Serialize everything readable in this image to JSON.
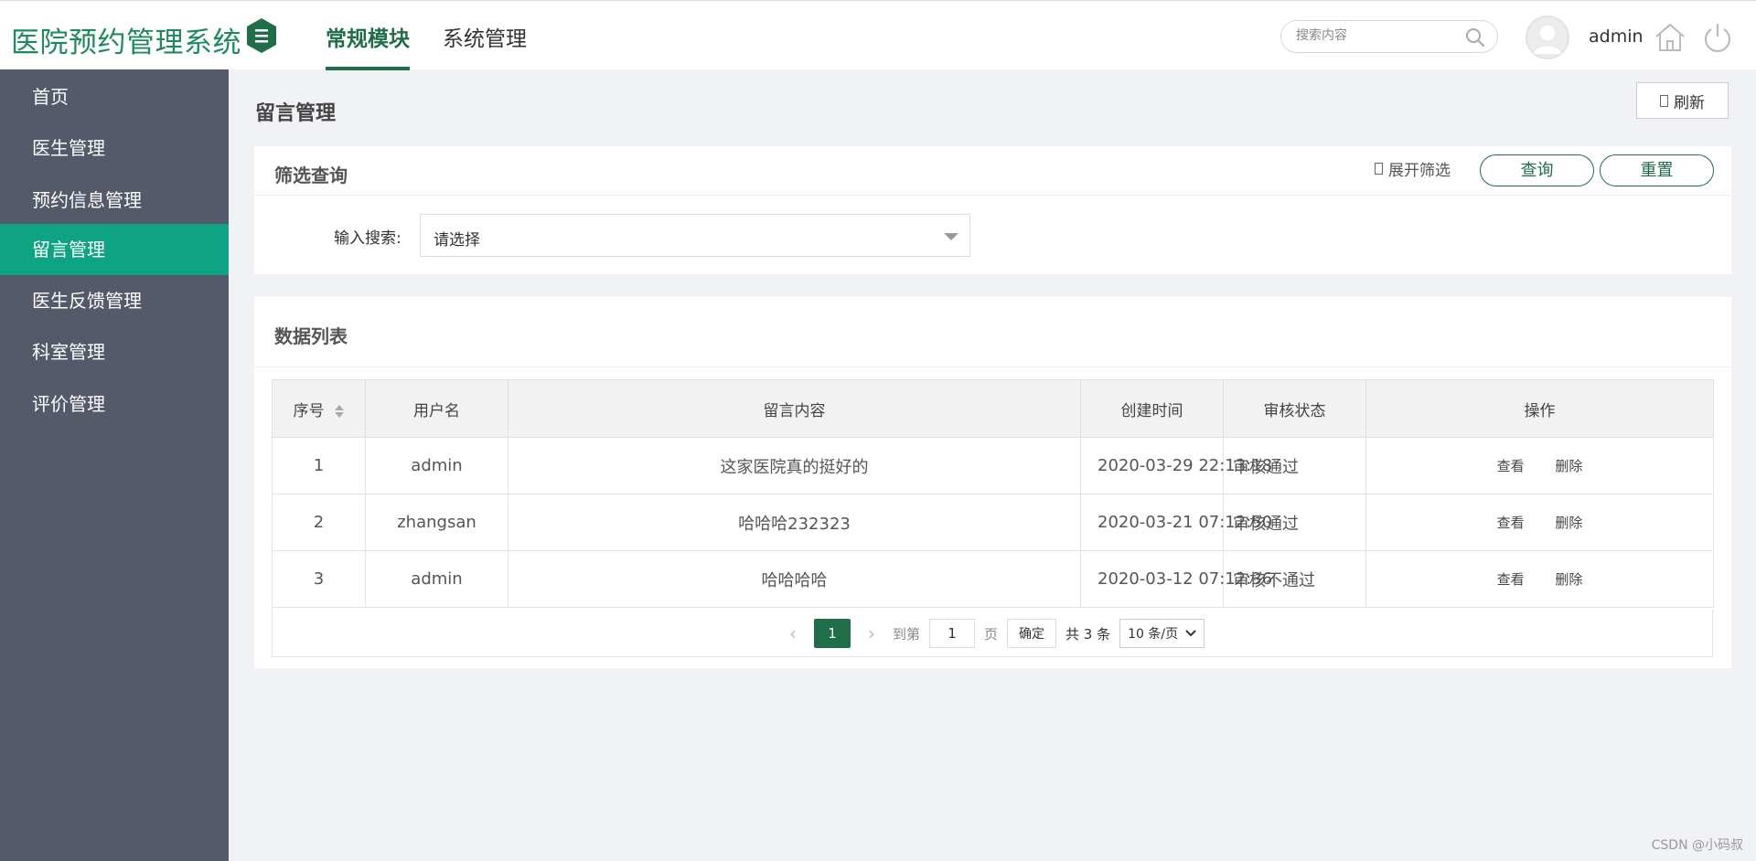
{
  "app": {
    "title": "医院预约管理系统"
  },
  "topnav": {
    "tabs": [
      {
        "label": "常规模块",
        "active": true
      },
      {
        "label": "系统管理",
        "active": false
      }
    ]
  },
  "search": {
    "placeholder": "搜索内容"
  },
  "user": {
    "name": "admin"
  },
  "icons": {
    "menu": "menu-hex-icon",
    "search": "search-icon",
    "avatar": "user-avatar-icon",
    "home": "home-icon",
    "power": "power-icon",
    "sort": "sort-icon"
  },
  "colors": {
    "brand": "#1f8a5e",
    "accent": "#1f6e48",
    "sidebar_bg": "#545a69",
    "sidebar_active": "#0fa386"
  },
  "sidebar": {
    "items": [
      {
        "label": "首页",
        "active": false
      },
      {
        "label": "医生管理",
        "active": false
      },
      {
        "label": "预约信息管理",
        "active": false
      },
      {
        "label": "留言管理",
        "active": true
      },
      {
        "label": "医生反馈管理",
        "active": false
      },
      {
        "label": "科室管理",
        "active": false
      },
      {
        "label": "评价管理",
        "active": false
      }
    ]
  },
  "page": {
    "title": "留言管理",
    "refresh_label": "刷新"
  },
  "filter": {
    "title": "筛选查询",
    "expand_label": "展开筛选",
    "query_label": "查询",
    "reset_label": "重置",
    "search_label": "输入搜索:",
    "select_value": "请选择"
  },
  "table": {
    "title": "数据列表",
    "columns": [
      "序号",
      "用户名",
      "留言内容",
      "创建时间",
      "审核状态",
      "操作"
    ],
    "rows": [
      {
        "index": "1",
        "username": "admin",
        "content": "这家医院真的挺好的",
        "created": "2020-03-29 22:13:18",
        "status": "审核通过"
      },
      {
        "index": "2",
        "username": "zhangsan",
        "content": "哈哈哈232323",
        "created": "2020-03-21 07:12:50",
        "status": "审核通过"
      },
      {
        "index": "3",
        "username": "admin",
        "content": "哈哈哈哈",
        "created": "2020-03-12 07:12:36",
        "status": "审核不通过"
      }
    ],
    "actions": {
      "view": "查看",
      "delete": "删除"
    }
  },
  "pagination": {
    "current_page": "1",
    "goto_prefix": "到第",
    "goto_value": "1",
    "goto_suffix": "页",
    "confirm_label": "确定",
    "total_label": "共 3 条",
    "page_size": "10 条/页"
  },
  "watermark": "CSDN @小码叔"
}
